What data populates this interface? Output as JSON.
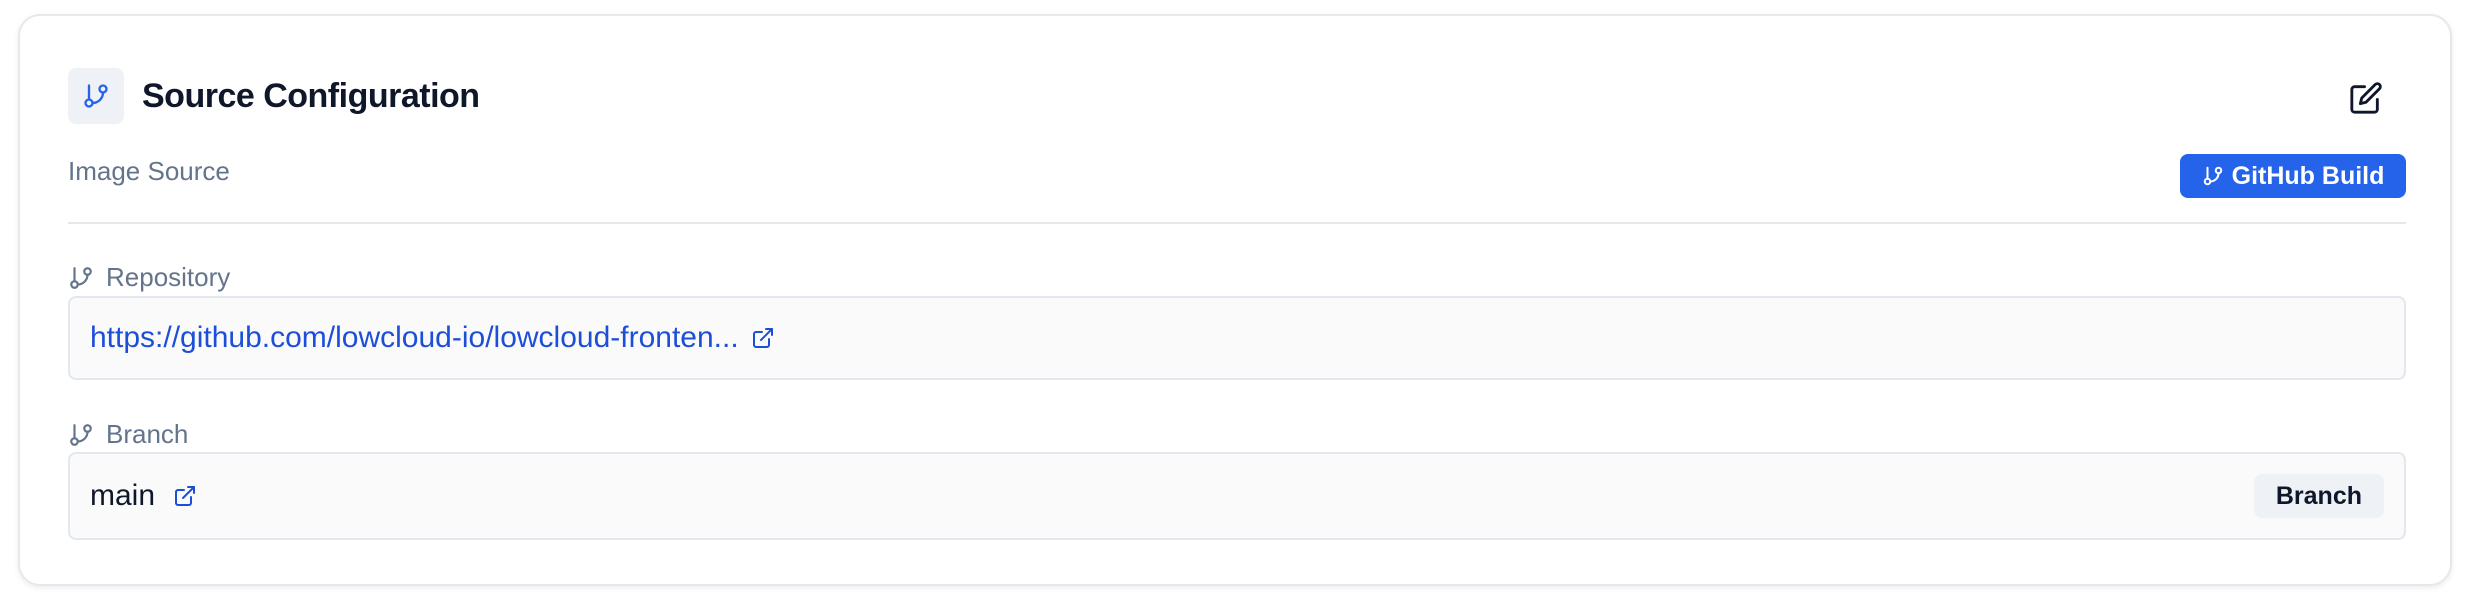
{
  "header": {
    "title": "Source Configuration",
    "icon": "git-branch-icon",
    "edit_icon": "edit-icon"
  },
  "image_source": {
    "label": "Image Source",
    "badge_label": "GitHub Build",
    "badge_color": "#2563eb"
  },
  "repository": {
    "label": "Repository",
    "value": "https://github.com/lowcloud-io/lowcloud-fronten...",
    "link_color": "#1d4ed8"
  },
  "branch": {
    "label": "Branch",
    "value": "main",
    "tag": "Branch"
  }
}
